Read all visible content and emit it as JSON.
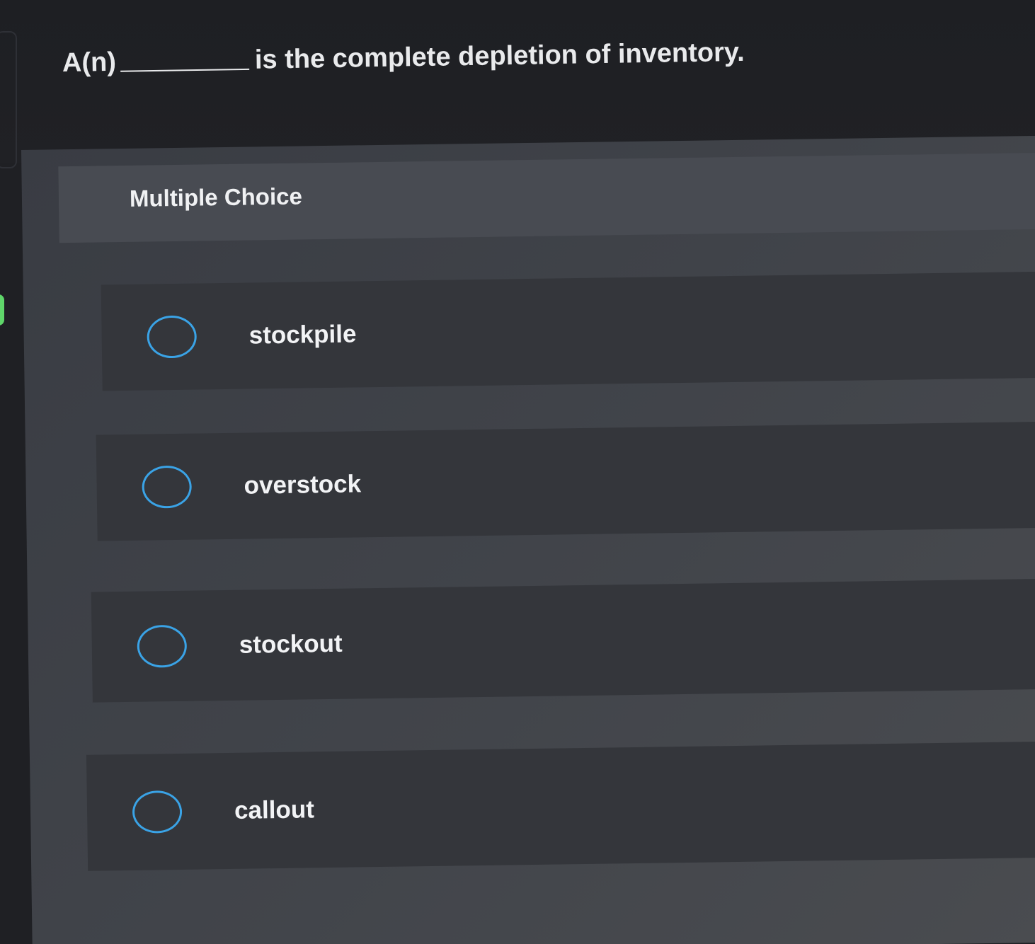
{
  "question": {
    "prefix": "A(n)",
    "suffix": "is the complete depletion of inventory."
  },
  "section_label": "Multiple Choice",
  "options": [
    {
      "label": "stockpile"
    },
    {
      "label": "overstock"
    },
    {
      "label": "stockout"
    },
    {
      "label": "callout"
    }
  ],
  "colors": {
    "background": "#1f2024",
    "panel": "#41444a",
    "option_bg": "#34363b",
    "radio_accent": "#3aa3e6",
    "text": "#f0f1f3"
  }
}
